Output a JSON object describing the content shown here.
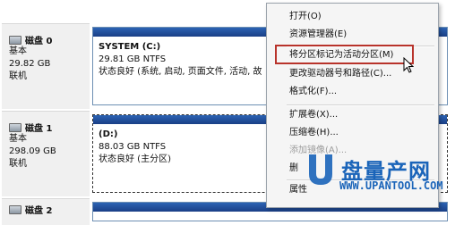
{
  "disks": [
    {
      "name": "磁盘 0",
      "type": "基本",
      "size": "29.82 GB",
      "status": "联机",
      "partition": {
        "title": "SYSTEM  (C:)",
        "size_fs": "29.81 GB NTFS",
        "status": "状态良好 (系统, 启动, 页面文件, 活动, 故"
      }
    },
    {
      "name": "磁盘 1",
      "type": "基本",
      "size": "298.09 GB",
      "status": "联机",
      "partition": {
        "title": "(D:)",
        "size_fs": "88.03 GB NTFS",
        "status": "状态良好 (主分区)"
      }
    },
    {
      "name": "磁盘 2"
    }
  ],
  "context_menu": {
    "items": [
      {
        "label": "打开(O)",
        "enabled": true
      },
      {
        "label": "资源管理器(E)",
        "enabled": true
      },
      {
        "label": "将分区标记为活动分区(M)",
        "enabled": true,
        "highlighted": true
      },
      {
        "label": "更改驱动器号和路径(C)...",
        "enabled": true
      },
      {
        "label": "格式化(F)...",
        "enabled": true
      },
      {
        "label": "扩展卷(X)...",
        "enabled": true
      },
      {
        "label": "压缩卷(H)...",
        "enabled": true
      },
      {
        "label": "添加镜像(A)...",
        "enabled": false
      },
      {
        "label": "删",
        "enabled": true
      },
      {
        "label": "属性",
        "enabled": true
      }
    ]
  },
  "watermark": {
    "brand": "盘量产网",
    "url": "WWW.UPANTOOL.COM"
  },
  "colors": {
    "partition_bar": "#1f4d9e",
    "highlight_box": "#b8332b",
    "watermark": "#1a64b9"
  }
}
